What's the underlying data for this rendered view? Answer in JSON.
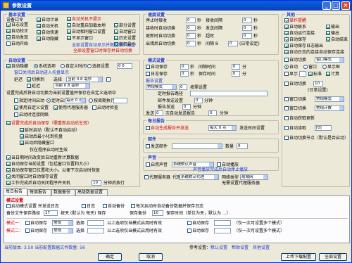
{
  "window": {
    "title": "参数设置",
    "minimize": "_",
    "maximize": "□",
    "close": "×"
  },
  "basic": {
    "title": "基本设置",
    "subtitle": "设备口令",
    "col1": [
      "日志设置",
      "自动校正",
      "自动发现",
      "自动开始"
    ],
    "col2": [
      "自动计录",
      "自动关机",
      "自动快速",
      "自动隐藏"
    ],
    "col3": [
      "自动关机不提示",
      "自动重启加载本地",
      "自动相同窗口设置",
      "不显示窗口"
    ],
    "col4": [
      "部分设置",
      "自动窗口",
      "历史设置",
      "窗口最小"
    ],
    "red_line1": "全部设置自动显示并限制频率设置",
    "red_line2": "全部设置窗口时保存并自动切换"
  },
  "speed": {
    "title": "速度设置",
    "rows": [
      {
        "label": "停止时接收",
        "value": "0",
        "unit": "秒",
        "label2": "接收间隔",
        "value2": "0",
        "unit2": "秒"
      },
      {
        "label": "接收时自动切换",
        "value": "0",
        "unit": "秒",
        "label2": "发送间隔",
        "value2": "0",
        "unit2": "秒"
      },
      {
        "label": "更新时自动切换",
        "value": "0",
        "unit": "秒",
        "label2": "超时",
        "value2": "0",
        "unit2": "秒"
      },
      {
        "label": "出错后自动切换",
        "value": "0",
        "unit": "秒",
        "label2": "间隔 8",
        "value2": "0",
        "unit2": "(日常设定)"
      }
    ]
  },
  "other": {
    "title": "其他",
    "items": [
      {
        "label": "操作提醒",
        "on": true,
        "red": true
      },
      {
        "label": "自动联系",
        "on": true,
        "label2": "输出",
        "on2": true
      },
      {
        "label": "自动运行连接",
        "on": true,
        "label2": "输出",
        "on2": true
      },
      {
        "label": "自动保存",
        "on": true,
        "label2": "自动结束",
        "on2": true
      },
      {
        "label": "自动保存日志输出",
        "on": true,
        "label2": "输出",
        "on2": true
      },
      {
        "label": "自动日志的连接自动保存连接",
        "on": true
      }
    ],
    "auto_switch_label": "自动切换",
    "auto_switch_value": "窗口模式",
    "opts": [
      "自动",
      "窗口",
      "显示框",
      "标准"
    ],
    "sub_labels": [
      "显示",
      "标准",
      "计算",
      "正常"
    ],
    "timer_label": "自动切换",
    "timer_value": "10",
    "timer_note": "(日常设置)",
    "row_a_label": "窗口切换",
    "row_a_value": "常规模式",
    "row_b_label": "窗口切换",
    "row_b_value": "常规计数",
    "row_c_label": "自动获取更新",
    "row_d_label": "自动读取",
    "row_d_value": "[0]",
    "row_e_label": "自动切换节点（默认是否启动）"
  },
  "auto": {
    "title": "自动设置",
    "line1_label": "自动隐藏",
    "line1_opts": [
      "系统选项",
      "自定义时间",
      "选择设置"
    ],
    "line1_value": "0 0",
    "line2_label": "窗口关闭后自动进入托盘显示",
    "sub_rows": [
      {
        "label": "延迟",
        "value": "切换到",
        "label2": "选择",
        "value2": "当前 0.8 毫秒"
      },
      {
        "label": "延迟",
        "value": "0 0",
        "label2": "选择",
        "value2": "当前 0.8 毫秒"
      }
    ],
    "note": "设置完成后将自动切换为当前设置值并保存在自定义选项中",
    "opt_a": "指定时间启动",
    "opt_b": "定时启动",
    "opt_c": "按周期执行",
    "period_value": "每天 0 点",
    "checks": [
      {
        "label": "使用自定义设置",
        "on": true
      },
      {
        "label": "使用代理服务器",
        "on": true
      },
      {
        "label": "启动时检查",
        "on": false
      },
      {
        "label": "启动时连接网络",
        "on": false
      }
    ],
    "red_check": "设置完成后自动保存（需重新启动后生效）",
    "sub_checks": [
      {
        "label": "延时启动（默认不自动启动）",
        "on": true
      },
      {
        "label": "启动后最小化到托盘",
        "on": true
      },
      {
        "label": "启动后隐藏窗口",
        "on": true
      }
    ],
    "extra_note": "仅在程序启动时生效",
    "bottom_checks": [
      {
        "label": "当日期时间改变后自动重新计算数据",
        "on": true
      },
      {
        "label": "自动保存当前设置（包括窗口位置和大小）",
        "on": true
      },
      {
        "label": "自动保存窗口位置和大小，以便下次启动时恢复",
        "on": true
      },
      {
        "label": "关闭窗口时自动保存设置",
        "on": true
      },
      {
        "label": "工作完成后自动关闭程序并关机",
        "on": true,
        "value": "10",
        "unit": "分钟后执行"
      }
    ]
  },
  "task": {
    "title": "模式设置",
    "rows": [
      {
        "label": "自动保存",
        "value": "0",
        "unit": "秒",
        "label2": "间隔时间",
        "value2": "0",
        "unit2": "分"
      },
      {
        "label": "日志保存",
        "value": "0",
        "unit": "秒",
        "label2": "保存时间",
        "value2": "0",
        "unit2": "分"
      }
    ],
    "sub_title": "报告设置",
    "log_value": "常规模式",
    "log_value2": "0",
    "log_note": "按需设置",
    "path_label": "定时报告路径",
    "path_value": "",
    "send_label": "邮件发送设置",
    "send_value": "0",
    "send_unit": "分钟",
    "send2_label": "报告发送",
    "send2_value": "0",
    "send2_unit": "分钟",
    "count_label": "发送",
    "count_value": "0",
    "count_unit": "次自动发送报告",
    "count2_value": "0",
    "count2_unit": "分钟"
  },
  "daily": {
    "title": "每日报告",
    "check": "自动生成报告并发送",
    "value": "每天 0 点",
    "note": "发送时间设置"
  },
  "mail": {
    "title": "邮件",
    "check": "发送邮件",
    "value": "",
    "label2": "数量",
    "value2": "0"
  },
  "sound": {
    "title": "声音",
    "check": "启用声音",
    "value": "系统默认声音",
    "check2": "自动播放",
    "note": "声音播放完成后自动停止播放"
  },
  "network": {
    "check": "代理服务器",
    "label": "代理",
    "value": "系统默认代理",
    "label2": "网络类型",
    "value2": "局域网",
    "note": "无需设置代理服务器"
  },
  "tabs": [
    "每日报告",
    "每周报告",
    "数据备份",
    "高级数据设置"
  ],
  "panel": {
    "title": "模式设置",
    "row1": [
      {
        "label": "启动模式设置 并发送日志",
        "on": false
      },
      {
        "label": "日志",
        "on": false
      },
      {
        "label": "自动备份",
        "on": false
      },
      {
        "label": "每次启动时自动备份数据并保存日志",
        "on": false
      }
    ],
    "row2_label": "备份文件保存路径",
    "row2_value": "17",
    "row2_note": "按天 (默认为 每天) 保存",
    "row2_label2": "保存备份",
    "row2_value2": "10",
    "row2_note2": "保存时间（单位为天，默认为 ...）",
    "modeA_label": "模式一：",
    "modeA_check": "自动保存",
    "modeA_value": "常规",
    "modeA_label2": "选择",
    "modeA_value2": "",
    "modeA_note": "以上选项仅当模式启用时有效",
    "modeA_label3": "自动保存",
    "modeA_value3": "",
    "modeA_note2": "（仅一次可设置多个模式）",
    "modeB_label": "模式二：",
    "modeB_check": "自动保存",
    "modeB_value": "常规",
    "modeB_label2": "选择",
    "modeB_value2": "",
    "modeB_note": "以上选项仅当模式启用时有效",
    "modeB_label3": "自动保存",
    "modeB_value3": "",
    "modeB_note2": "（仅一次可设置多个模式）"
  },
  "status": {
    "left": "当前版本: 3.50  当前配置数据文件数量: 56",
    "right_label": "参考设置：",
    "right_links": [
      "默认设置",
      "帮助设置",
      "其他设置"
    ]
  },
  "buttons": {
    "ok": "确定",
    "cancel": "取消",
    "upload": "上传下载配置",
    "all": "全部设置"
  }
}
